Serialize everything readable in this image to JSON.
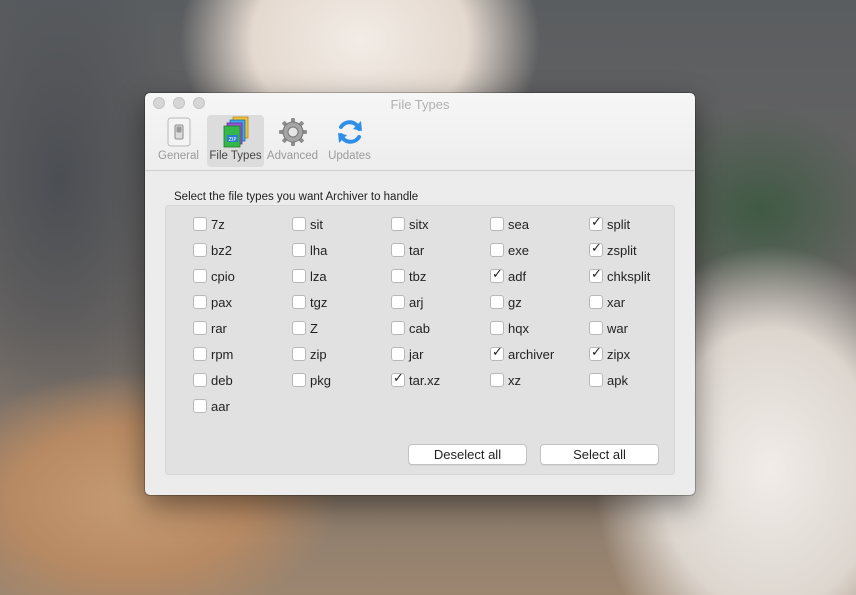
{
  "window": {
    "title": "File Types"
  },
  "toolbar": {
    "tabs": [
      {
        "label": "General",
        "icon": "switch-icon"
      },
      {
        "label": "File Types",
        "icon": "zip-files-icon",
        "selected": true
      },
      {
        "label": "Advanced",
        "icon": "gear-icon"
      },
      {
        "label": "Updates",
        "icon": "refresh-icon"
      }
    ]
  },
  "instruction": "Select the file types you want Archiver to handle",
  "columns": [
    [
      {
        "label": "7z",
        "checked": false
      },
      {
        "label": "bz2",
        "checked": false
      },
      {
        "label": "cpio",
        "checked": false
      },
      {
        "label": "pax",
        "checked": false
      },
      {
        "label": "rar",
        "checked": false
      },
      {
        "label": "rpm",
        "checked": false
      },
      {
        "label": "deb",
        "checked": false
      },
      {
        "label": "aar",
        "checked": false
      }
    ],
    [
      {
        "label": "sit",
        "checked": false
      },
      {
        "label": "lha",
        "checked": false
      },
      {
        "label": "lza",
        "checked": false
      },
      {
        "label": "tgz",
        "checked": false
      },
      {
        "label": "Z",
        "checked": false
      },
      {
        "label": "zip",
        "checked": false
      },
      {
        "label": "pkg",
        "checked": false
      }
    ],
    [
      {
        "label": "sitx",
        "checked": false
      },
      {
        "label": "tar",
        "checked": false
      },
      {
        "label": "tbz",
        "checked": false
      },
      {
        "label": "arj",
        "checked": false
      },
      {
        "label": "cab",
        "checked": false
      },
      {
        "label": "jar",
        "checked": false
      },
      {
        "label": "tar.xz",
        "checked": true
      }
    ],
    [
      {
        "label": "sea",
        "checked": false
      },
      {
        "label": "exe",
        "checked": false
      },
      {
        "label": "adf",
        "checked": true
      },
      {
        "label": "gz",
        "checked": false
      },
      {
        "label": "hqx",
        "checked": false
      },
      {
        "label": "archiver",
        "checked": true
      },
      {
        "label": "xz",
        "checked": false
      }
    ],
    [
      {
        "label": "split",
        "checked": true
      },
      {
        "label": "zsplit",
        "checked": true
      },
      {
        "label": "chksplit",
        "checked": true
      },
      {
        "label": "xar",
        "checked": false
      },
      {
        "label": "war",
        "checked": false
      },
      {
        "label": "zipx",
        "checked": true
      },
      {
        "label": "apk",
        "checked": false
      }
    ]
  ],
  "buttons": {
    "deselect_all": "Deselect all",
    "select_all": "Select all"
  },
  "colors": {
    "accent": "#2f8ee8",
    "window_bg": "#ececec"
  }
}
